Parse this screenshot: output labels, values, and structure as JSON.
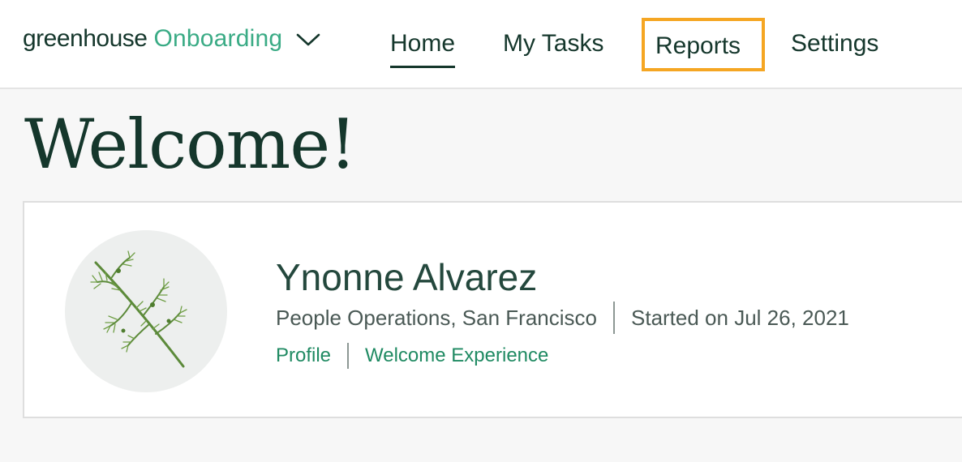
{
  "brand": {
    "wordmark": "greenhouse",
    "product": "Onboarding",
    "chevron_icon": "chevron-down-icon",
    "product_color": "#3aab85"
  },
  "nav": {
    "items": [
      {
        "label": "Home",
        "active": true
      },
      {
        "label": "My Tasks",
        "active": false
      },
      {
        "label": "Reports",
        "highlighted": true
      },
      {
        "label": "Settings",
        "active": false
      }
    ],
    "highlight_color": "#f5a623"
  },
  "page": {
    "title": "Welcome!"
  },
  "profile_card": {
    "avatar_icon": "dill-plant-icon",
    "name": "Ynonne Alvarez",
    "department_location": "People Operations, San Francisco",
    "start_date": "Started on Jul 26, 2021",
    "links": [
      {
        "label": "Profile"
      },
      {
        "label": "Welcome Experience"
      }
    ],
    "link_color": "#1f8a62"
  }
}
